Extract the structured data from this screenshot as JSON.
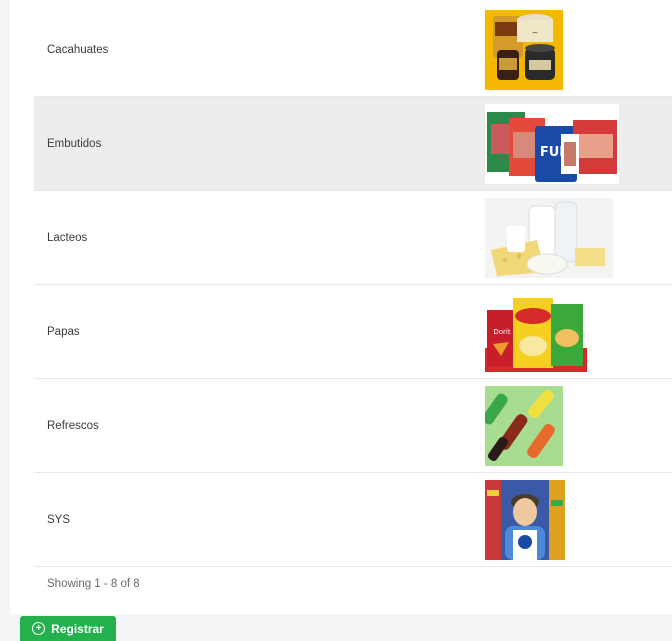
{
  "rows": [
    {
      "label": "Cacahuates",
      "image": "peanuts-product-image"
    },
    {
      "label": "Embutidos",
      "image": "cold-cuts-product-image"
    },
    {
      "label": "Lacteos",
      "image": "dairy-product-image"
    },
    {
      "label": "Papas",
      "image": "chips-product-image"
    },
    {
      "label": "Refrescos",
      "image": "soda-product-image"
    },
    {
      "label": "SYS",
      "image": "mascot-product-image"
    }
  ],
  "footer": {
    "showing": "Showing 1 - 8 of 8"
  },
  "actions": {
    "register_label": "Registrar",
    "register_icon": "plus-circle-icon"
  },
  "colors": {
    "accent": "#22b14c",
    "highlight_row": "#ededee"
  }
}
